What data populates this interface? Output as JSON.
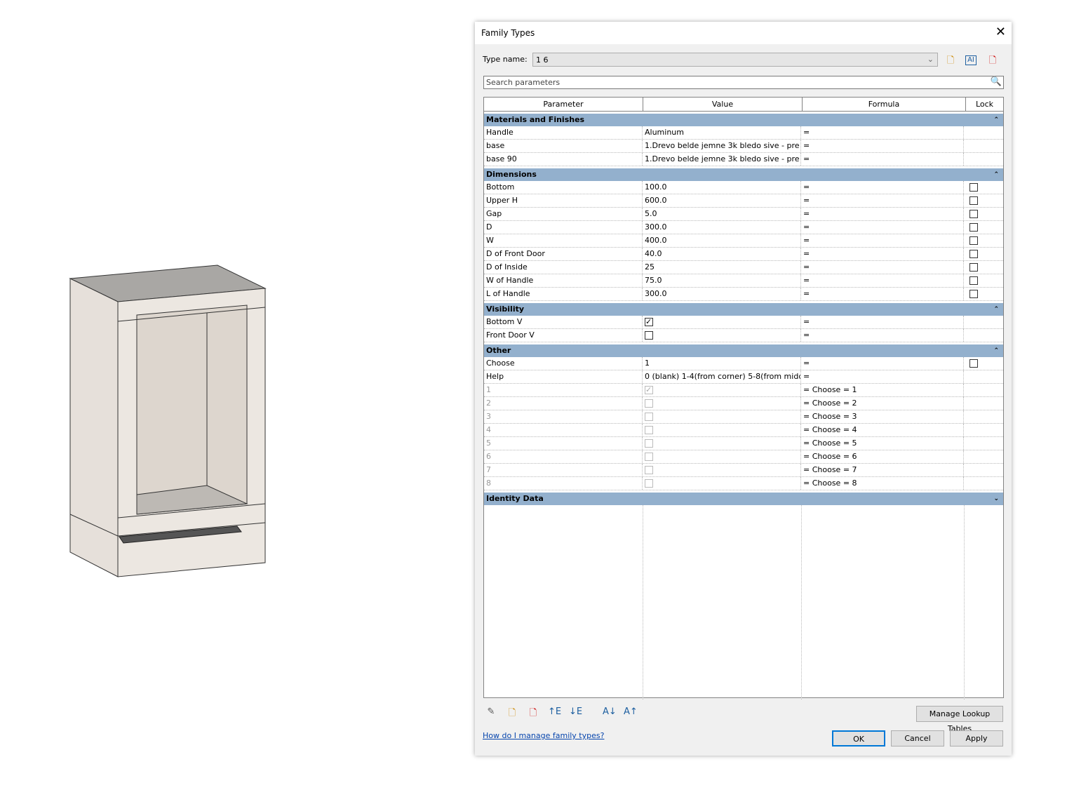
{
  "dialog": {
    "title": "Family Types",
    "type_name_label": "Type name:",
    "type_name_value": "1 6",
    "search_placeholder": "Search parameters"
  },
  "columns": [
    "Parameter",
    "Value",
    "Formula",
    "Lock"
  ],
  "sections": [
    {
      "name": "Materials and Finishes",
      "collapse": "⌃",
      "rows": [
        {
          "param": "Handle",
          "value": "Aluminum",
          "formula": "="
        },
        {
          "param": "base",
          "value": "1.Drevo belde jemne 3k bledo sive - pre",
          "formula": "="
        },
        {
          "param": "base 90",
          "value": "1.Drevo belde jemne 3k bledo sive - pre",
          "formula": "="
        }
      ]
    },
    {
      "name": "Dimensions",
      "collapse": "⌃",
      "rows": [
        {
          "param": "Bottom",
          "value": "100.0",
          "formula": "=",
          "lock": false
        },
        {
          "param": "Upper H",
          "value": "600.0",
          "formula": "=",
          "lock": false
        },
        {
          "param": "Gap",
          "value": "5.0",
          "formula": "=",
          "lock": false
        },
        {
          "param": "D",
          "value": "300.0",
          "formula": "=",
          "lock": false
        },
        {
          "param": "W",
          "value": "400.0",
          "formula": "=",
          "lock": false
        },
        {
          "param": "D of Front Door",
          "value": "40.0",
          "formula": "=",
          "lock": false
        },
        {
          "param": "D of Inside",
          "value": "25",
          "formula": "=",
          "lock": false
        },
        {
          "param": "W of Handle",
          "value": "75.0",
          "formula": "=",
          "lock": false
        },
        {
          "param": "L of Handle",
          "value": "300.0",
          "formula": "=",
          "lock": false
        }
      ]
    },
    {
      "name": "Visibility",
      "collapse": "⌃",
      "rows": [
        {
          "param": "Bottom V",
          "check": true,
          "formula": "="
        },
        {
          "param": "Front Door V",
          "check": false,
          "formula": "="
        }
      ]
    },
    {
      "name": "Other",
      "collapse": "⌃",
      "rows": [
        {
          "param": "Choose",
          "value": "1",
          "formula": "=",
          "lock": false
        },
        {
          "param": "Help",
          "value": "0 (blank) 1-4(from corner) 5-8(from middl",
          "formula": "="
        },
        {
          "param": "1",
          "check": true,
          "disabled": true,
          "formula": "= Choose = 1"
        },
        {
          "param": "2",
          "check": false,
          "disabled": true,
          "formula": "= Choose = 2"
        },
        {
          "param": "3",
          "check": false,
          "disabled": true,
          "formula": "= Choose = 3"
        },
        {
          "param": "4",
          "check": false,
          "disabled": true,
          "formula": "= Choose = 4"
        },
        {
          "param": "5",
          "check": false,
          "disabled": true,
          "formula": "= Choose = 5"
        },
        {
          "param": "6",
          "check": false,
          "disabled": true,
          "formula": "= Choose = 6"
        },
        {
          "param": "7",
          "check": false,
          "disabled": true,
          "formula": "= Choose = 7"
        },
        {
          "param": "8",
          "check": false,
          "disabled": true,
          "formula": "= Choose = 8"
        }
      ]
    },
    {
      "name": "Identity Data",
      "collapse": "⌄",
      "rows": []
    }
  ],
  "buttons": {
    "manage_lookup": "Manage Lookup Tables",
    "ok": "OK",
    "cancel": "Cancel",
    "apply": "Apply"
  },
  "help_link": "How do I manage family types?"
}
